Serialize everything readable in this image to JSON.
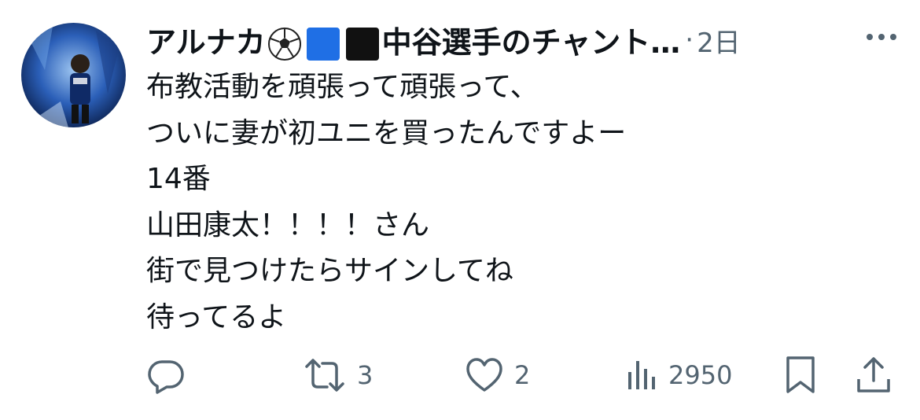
{
  "post": {
    "author_name": "アルナカ⚽🟦⬛中谷選手のチャント…",
    "author_name_text": "アルナカ",
    "author_name_suffix": "中谷選手のチャント…",
    "separator": "·",
    "timestamp": "2日",
    "body_lines": [
      "布教活動を頑張って頑張って、",
      "ついに妻が初ユニを買ったんですよー",
      "14番",
      "山田康太！！！！さん",
      "街で見つけたらサインしてね",
      "待ってるよ"
    ]
  },
  "actions": {
    "reply_count": "",
    "repost_count": "3",
    "like_count": "2",
    "views_count": "2950"
  },
  "icons": {
    "more": "more-dots-icon",
    "reply": "reply-icon",
    "repost": "repost-icon",
    "like": "heart-icon",
    "views": "views-bar-chart-icon",
    "bookmark": "bookmark-icon",
    "share": "share-icon"
  },
  "colors": {
    "text": "#0f1419",
    "muted": "#536471",
    "avatar_blue": "#2b5fb8",
    "emoji_blue": "#1f6fe5",
    "emoji_black": "#111111"
  }
}
